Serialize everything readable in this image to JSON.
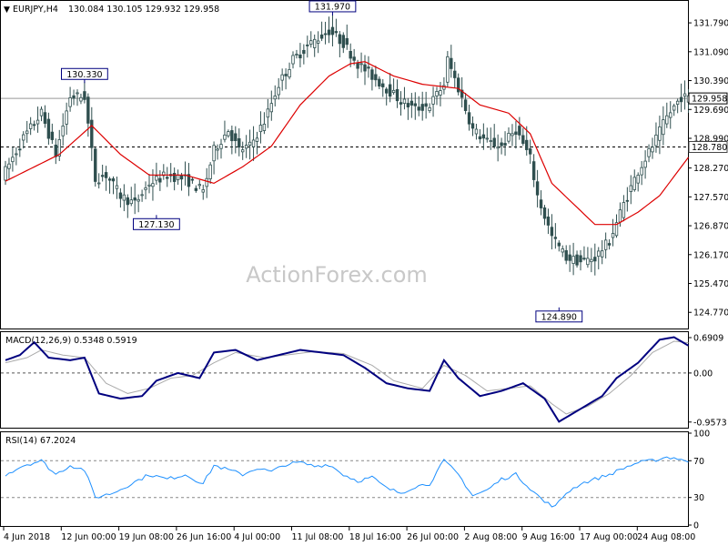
{
  "header": {
    "symbol": "EURJPY,H4",
    "ohlc": "130.084 130.105 129.932 129.958"
  },
  "watermark": "ActionForex.com",
  "colors": {
    "candle": "#2f4f4f",
    "ma": "#dd0000",
    "macd_line": "#00007f",
    "macd_signal": "#aaaaaa",
    "rsi": "#1e90ff",
    "grid_ref": "#999999",
    "box_border": "#00007f"
  },
  "chart_data": [
    {
      "type": "candlestick",
      "title": "EURJPY,H4",
      "ylim": [
        124.4,
        132.3
      ],
      "ytick_labels": [
        "131.790",
        "131.090",
        "130.390",
        "129.690",
        "128.990",
        "128.270",
        "127.570",
        "126.870",
        "126.170",
        "125.470",
        "124.770"
      ],
      "ytick_values": [
        131.79,
        131.09,
        130.39,
        129.69,
        128.99,
        128.27,
        127.57,
        126.87,
        126.17,
        125.47,
        124.77
      ],
      "current_price": "129.958",
      "current_price_value": 129.958,
      "support_level": "128.780",
      "support_level_value": 128.78,
      "annotations": [
        {
          "label": "130.330",
          "idx": 22,
          "value": 130.33
        },
        {
          "label": "127.130",
          "idx": 42,
          "value": 127.13
        },
        {
          "label": "131.970",
          "idx": 91,
          "value": 131.97
        },
        {
          "label": "124.890",
          "idx": 154,
          "value": 124.89
        }
      ],
      "anchors_close": [
        [
          0,
          128.2
        ],
        [
          5,
          129.0
        ],
        [
          10,
          129.6
        ],
        [
          14,
          128.6
        ],
        [
          18,
          130.0
        ],
        [
          22,
          130.0
        ],
        [
          25,
          128.0
        ],
        [
          28,
          128.1
        ],
        [
          32,
          127.6
        ],
        [
          36,
          127.4
        ],
        [
          40,
          127.9
        ],
        [
          45,
          128.1
        ],
        [
          50,
          128.0
        ],
        [
          55,
          127.7
        ],
        [
          58,
          128.7
        ],
        [
          62,
          129.2
        ],
        [
          65,
          128.7
        ],
        [
          68,
          128.8
        ],
        [
          72,
          129.4
        ],
        [
          76,
          130.3
        ],
        [
          80,
          130.9
        ],
        [
          85,
          131.3
        ],
        [
          90,
          131.6
        ],
        [
          94,
          131.3
        ],
        [
          98,
          130.8
        ],
        [
          102,
          130.5
        ],
        [
          106,
          130.2
        ],
        [
          110,
          129.9
        ],
        [
          114,
          129.7
        ],
        [
          118,
          129.8
        ],
        [
          122,
          130.3
        ],
        [
          123,
          130.9
        ],
        [
          126,
          130.2
        ],
        [
          130,
          129.2
        ],
        [
          134,
          128.9
        ],
        [
          138,
          128.8
        ],
        [
          142,
          129.2
        ],
        [
          146,
          128.5
        ],
        [
          148,
          127.6
        ],
        [
          152,
          126.6
        ],
        [
          156,
          126.1
        ],
        [
          160,
          126.0
        ],
        [
          164,
          126.1
        ],
        [
          168,
          126.5
        ],
        [
          172,
          127.4
        ],
        [
          176,
          128.2
        ],
        [
          180,
          128.8
        ],
        [
          184,
          129.5
        ],
        [
          188,
          130.0
        ],
        [
          190,
          129.958
        ]
      ],
      "moving_average_anchors": [
        [
          0,
          127.95
        ],
        [
          15,
          128.6
        ],
        [
          24,
          129.3
        ],
        [
          32,
          128.6
        ],
        [
          40,
          128.1
        ],
        [
          50,
          128.1
        ],
        [
          58,
          127.9
        ],
        [
          66,
          128.3
        ],
        [
          74,
          128.8
        ],
        [
          82,
          129.8
        ],
        [
          90,
          130.5
        ],
        [
          96,
          130.8
        ],
        [
          100,
          130.85
        ],
        [
          108,
          130.5
        ],
        [
          116,
          130.3
        ],
        [
          126,
          130.2
        ],
        [
          132,
          129.8
        ],
        [
          140,
          129.6
        ],
        [
          146,
          129.1
        ],
        [
          152,
          127.9
        ],
        [
          158,
          127.4
        ],
        [
          164,
          126.9
        ],
        [
          170,
          126.9
        ],
        [
          176,
          127.2
        ],
        [
          182,
          127.6
        ],
        [
          190,
          128.53
        ]
      ],
      "xtick_labels": [
        "4 Jun 2018",
        "12 Jun 00:00",
        "19 Jun 08:00",
        "26 Jun 16:00",
        "4 Jul 00:00",
        "11 Jul 08:00",
        "18 Jul 16:00",
        "26 Jul 00:00",
        "2 Aug 08:00",
        "9 Aug 16:00",
        "17 Aug 00:00",
        "24 Aug 08:00"
      ]
    },
    {
      "type": "line",
      "title": "MACD(12,26,9) 0.5348 0.5919",
      "ylim": [
        -1.05,
        0.78
      ],
      "ytick_labels": [
        "0.6909",
        "0.00",
        "-0.9573"
      ],
      "ytick_values": [
        0.6909,
        0.0,
        -0.9573
      ],
      "series": [
        {
          "name": "MACD",
          "anchors": [
            [
              0,
              0.25
            ],
            [
              4,
              0.35
            ],
            [
              8,
              0.6
            ],
            [
              12,
              0.3
            ],
            [
              18,
              0.25
            ],
            [
              22,
              0.3
            ],
            [
              26,
              -0.4
            ],
            [
              32,
              -0.5
            ],
            [
              38,
              -0.45
            ],
            [
              42,
              -0.15
            ],
            [
              48,
              0.0
            ],
            [
              54,
              -0.1
            ],
            [
              58,
              0.4
            ],
            [
              64,
              0.45
            ],
            [
              70,
              0.25
            ],
            [
              76,
              0.35
            ],
            [
              82,
              0.45
            ],
            [
              88,
              0.4
            ],
            [
              94,
              0.35
            ],
            [
              100,
              0.1
            ],
            [
              106,
              -0.2
            ],
            [
              112,
              -0.3
            ],
            [
              118,
              -0.35
            ],
            [
              122,
              0.25
            ],
            [
              126,
              -0.1
            ],
            [
              132,
              -0.45
            ],
            [
              138,
              -0.35
            ],
            [
              144,
              -0.2
            ],
            [
              150,
              -0.5
            ],
            [
              154,
              -0.95
            ],
            [
              160,
              -0.7
            ],
            [
              166,
              -0.45
            ],
            [
              170,
              -0.1
            ],
            [
              176,
              0.2
            ],
            [
              182,
              0.65
            ],
            [
              186,
              0.7
            ],
            [
              190,
              0.5348
            ]
          ]
        },
        {
          "name": "Signal",
          "anchors": [
            [
              0,
              0.2
            ],
            [
              6,
              0.3
            ],
            [
              10,
              0.45
            ],
            [
              16,
              0.35
            ],
            [
              22,
              0.3
            ],
            [
              28,
              -0.2
            ],
            [
              34,
              -0.4
            ],
            [
              40,
              -0.3
            ],
            [
              46,
              -0.1
            ],
            [
              52,
              -0.05
            ],
            [
              58,
              0.2
            ],
            [
              64,
              0.4
            ],
            [
              72,
              0.3
            ],
            [
              78,
              0.35
            ],
            [
              86,
              0.42
            ],
            [
              94,
              0.38
            ],
            [
              102,
              0.15
            ],
            [
              108,
              -0.15
            ],
            [
              116,
              -0.3
            ],
            [
              122,
              0.15
            ],
            [
              128,
              -0.05
            ],
            [
              134,
              -0.35
            ],
            [
              140,
              -0.3
            ],
            [
              146,
              -0.25
            ],
            [
              152,
              -0.6
            ],
            [
              156,
              -0.8
            ],
            [
              162,
              -0.65
            ],
            [
              168,
              -0.4
            ],
            [
              174,
              -0.05
            ],
            [
              180,
              0.4
            ],
            [
              186,
              0.62
            ],
            [
              190,
              0.5919
            ]
          ]
        }
      ]
    },
    {
      "type": "line",
      "title": "RSI(14) 67.2024",
      "ylim": [
        0,
        100
      ],
      "ytick_labels": [
        "100",
        "70",
        "30",
        "0"
      ],
      "ytick_values": [
        100,
        70,
        30,
        0
      ],
      "levels": [
        70,
        30
      ],
      "series": [
        {
          "name": "RSI",
          "anchors": [
            [
              0,
              55
            ],
            [
              5,
              65
            ],
            [
              10,
              70
            ],
            [
              14,
              55
            ],
            [
              18,
              65
            ],
            [
              22,
              60
            ],
            [
              25,
              30
            ],
            [
              30,
              35
            ],
            [
              35,
              45
            ],
            [
              40,
              55
            ],
            [
              45,
              50
            ],
            [
              50,
              55
            ],
            [
              55,
              45
            ],
            [
              58,
              65
            ],
            [
              62,
              60
            ],
            [
              66,
              55
            ],
            [
              70,
              62
            ],
            [
              74,
              58
            ],
            [
              78,
              66
            ],
            [
              82,
              68
            ],
            [
              86,
              64
            ],
            [
              90,
              66
            ],
            [
              94,
              55
            ],
            [
              98,
              48
            ],
            [
              102,
              52
            ],
            [
              106,
              40
            ],
            [
              110,
              35
            ],
            [
              114,
              42
            ],
            [
              118,
              45
            ],
            [
              122,
              70
            ],
            [
              126,
              55
            ],
            [
              130,
              32
            ],
            [
              134,
              38
            ],
            [
              138,
              50
            ],
            [
              142,
              55
            ],
            [
              146,
              40
            ],
            [
              150,
              25
            ],
            [
              153,
              20
            ],
            [
              156,
              35
            ],
            [
              160,
              45
            ],
            [
              164,
              50
            ],
            [
              168,
              55
            ],
            [
              172,
              62
            ],
            [
              176,
              68
            ],
            [
              180,
              70
            ],
            [
              184,
              74
            ],
            [
              188,
              72
            ],
            [
              190,
              67.2
            ]
          ]
        }
      ]
    }
  ]
}
